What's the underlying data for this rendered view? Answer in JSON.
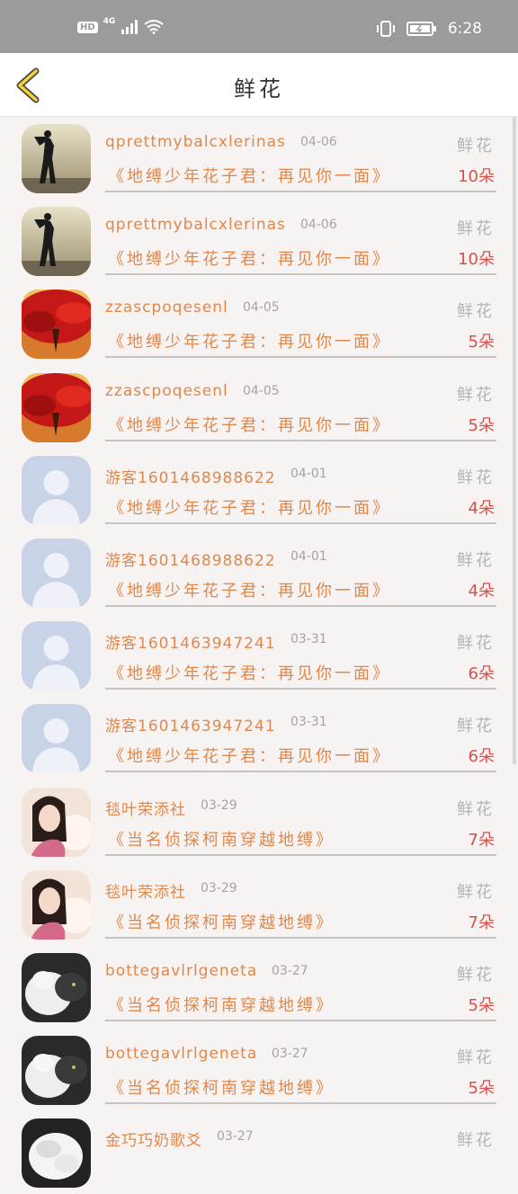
{
  "status_bar": {
    "hd": "HD",
    "network": "4G",
    "time": "6:28"
  },
  "header": {
    "title": "鲜花"
  },
  "items": [
    {
      "name": "qprettmybalcxlerinas",
      "date": "04-06",
      "type": "鲜花",
      "work": "《地缚少年花子君：再见你一面》",
      "count": "10朵",
      "avatar": "man-silhouette"
    },
    {
      "name": "qprettmybalcxlerinas",
      "date": "04-06",
      "type": "鲜花",
      "work": "《地缚少年花子君：再见你一面》",
      "count": "10朵",
      "avatar": "man-silhouette"
    },
    {
      "name": "zzascpoqesenl",
      "date": "04-05",
      "type": "鲜花",
      "work": "《地缚少年花子君：再见你一面》",
      "count": "5朵",
      "avatar": "red-tree"
    },
    {
      "name": "zzascpoqesenl",
      "date": "04-05",
      "type": "鲜花",
      "work": "《地缚少年花子君：再见你一面》",
      "count": "5朵",
      "avatar": "red-tree"
    },
    {
      "name": "游客1601468988622",
      "date": "04-01",
      "type": "鲜花",
      "work": "《地缚少年花子君：再见你一面》",
      "count": "4朵",
      "avatar": "default-user"
    },
    {
      "name": "游客1601468988622",
      "date": "04-01",
      "type": "鲜花",
      "work": "《地缚少年花子君：再见你一面》",
      "count": "4朵",
      "avatar": "default-user"
    },
    {
      "name": "游客1601463947241",
      "date": "03-31",
      "type": "鲜花",
      "work": "《地缚少年花子君：再见你一面》",
      "count": "6朵",
      "avatar": "default-user"
    },
    {
      "name": "游客1601463947241",
      "date": "03-31",
      "type": "鲜花",
      "work": "《地缚少年花子君：再见你一面》",
      "count": "6朵",
      "avatar": "default-user"
    },
    {
      "name": "毯叶荣添社",
      "date": "03-29",
      "type": "鲜花",
      "work": "《当名侦探柯南穿越地缚》",
      "count": "7朵",
      "avatar": "girl-photo"
    },
    {
      "name": "毯叶荣添社",
      "date": "03-29",
      "type": "鲜花",
      "work": "《当名侦探柯南穿越地缚》",
      "count": "7朵",
      "avatar": "girl-photo"
    },
    {
      "name": "bottegavlrlgeneta",
      "date": "03-27",
      "type": "鲜花",
      "work": "《当名侦探柯南穿越地缚》",
      "count": "5朵",
      "avatar": "cat-photo"
    },
    {
      "name": "bottegavlrlgeneta",
      "date": "03-27",
      "type": "鲜花",
      "work": "《当名侦探柯南穿越地缚》",
      "count": "5朵",
      "avatar": "cat-photo"
    },
    {
      "name": "金巧巧奶歌爻",
      "date": "03-27",
      "type": "鲜花",
      "work": "",
      "count": "",
      "avatar": "white-flower"
    }
  ]
}
